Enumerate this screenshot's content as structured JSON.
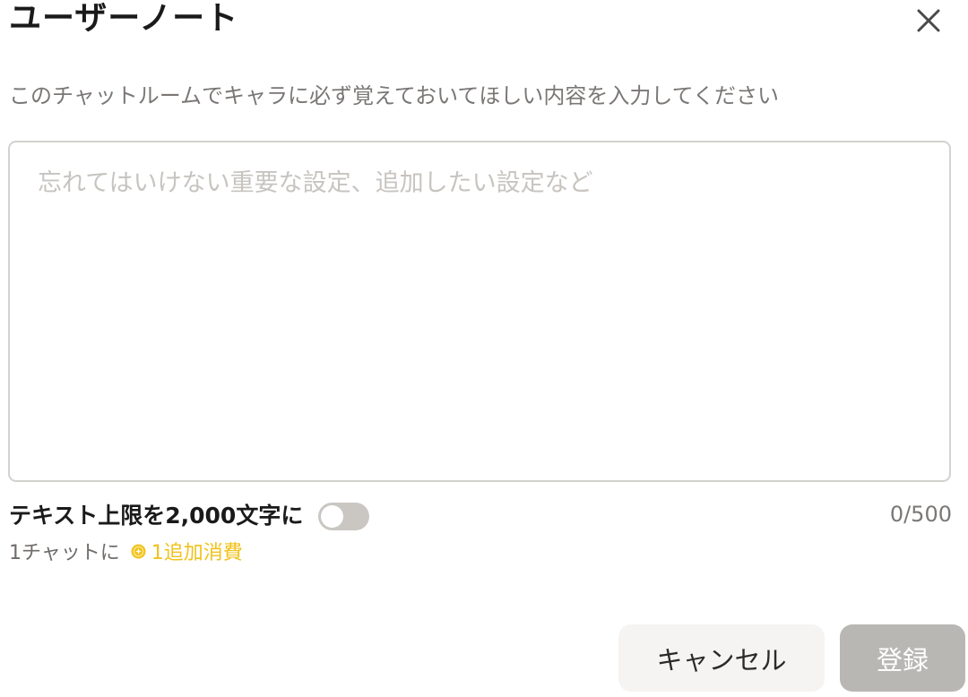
{
  "dialog": {
    "title": "ユーザーノート",
    "description": "このチャットルームでキャラに必ず覚えておいてほしい内容を入力してください",
    "close_icon": "close-icon"
  },
  "note": {
    "value": "",
    "placeholder": "忘れてはいけない重要な設定、追加したい設定など",
    "counter": "0/500"
  },
  "text_limit_option": {
    "label": "テキスト上限を2,000文字に",
    "enabled": false,
    "cost_prefix": "1チャットに",
    "cost_icon": "coin-icon",
    "cost_amount": "1追加消費"
  },
  "actions": {
    "cancel_label": "キャンセル",
    "register_label": "登録"
  },
  "colors": {
    "title": "#1a1a1a",
    "muted_text": "#7a7775",
    "border": "#d4d2cf",
    "toggle_off": "#cac7c2",
    "coin_accent": "#f0c21b",
    "cancel_bg": "#f5f4f2",
    "register_disabled_bg": "#b9b7b4"
  }
}
